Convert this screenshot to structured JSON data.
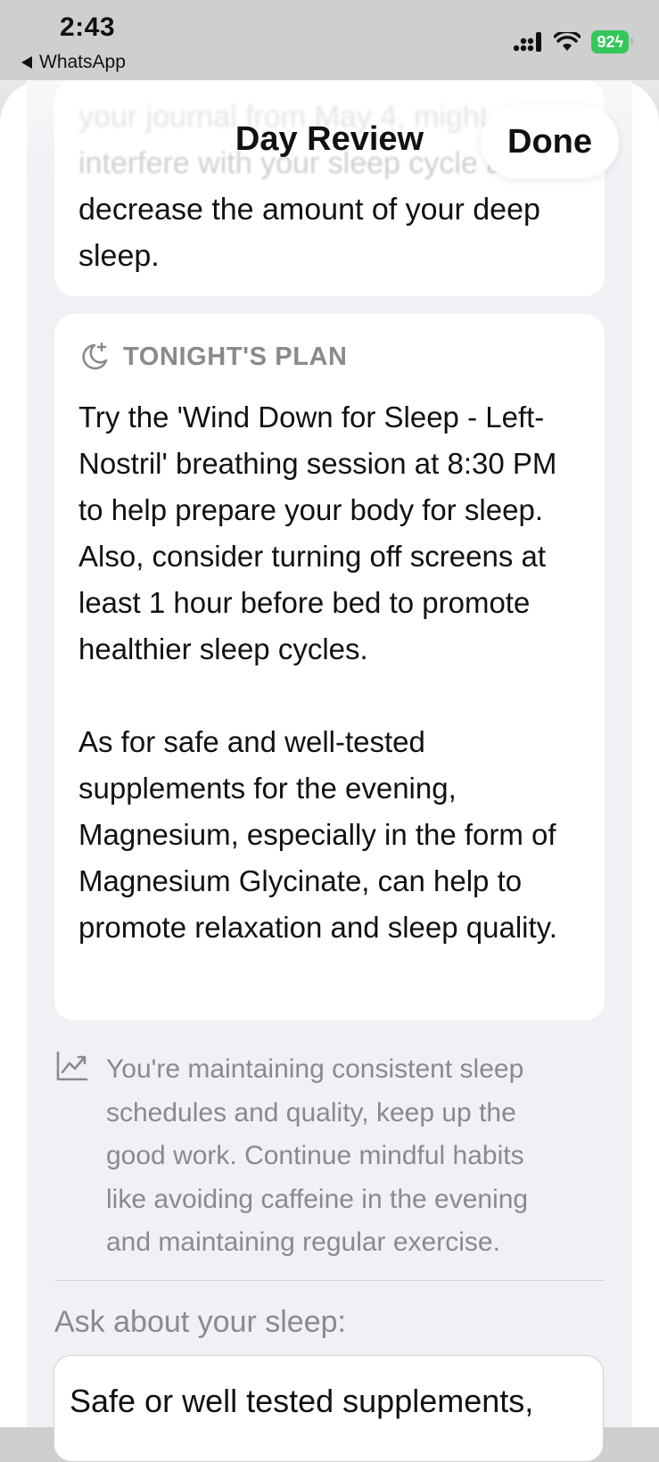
{
  "status_bar": {
    "time": "2:43",
    "back_app": "WhatsApp",
    "battery": "92"
  },
  "nav": {
    "title": "Day Review",
    "done_label": "Done"
  },
  "summary_card": {
    "faded_line_1": "your journal from May 4, might",
    "faded_line_2": "interfere with your sleep cycle and",
    "line_3": "decrease the amount of your deep",
    "line_4": "sleep."
  },
  "plan_card": {
    "icon": "moon-stars-icon",
    "label": "TONIGHT'S PLAN",
    "paragraph_1": "Try the 'Wind Down for Sleep - Left-Nostril' breathing session at 8:30 PM to help prepare your body for sleep. Also, consider turning off screens at least 1 hour before bed to promote healthier sleep cycles.",
    "paragraph_2": "As for safe and well-tested supplements for the evening, Magnesium, especially in the form of Magnesium Glycinate, can help to promote relaxation and sleep quality."
  },
  "trend": {
    "icon": "chart-trend-up-icon",
    "text": "You're maintaining consistent sleep schedules and quality, keep up the good work. Continue mindful habits like avoiding caffeine in the evening and maintaining regular exercise."
  },
  "ask": {
    "label": "Ask about your sleep:",
    "input_value": "Safe or well tested supplements,"
  },
  "colors": {
    "secondary_text": "#8a8a8e",
    "battery_green": "#34c759",
    "sheet_background": "#f0f0f5"
  }
}
